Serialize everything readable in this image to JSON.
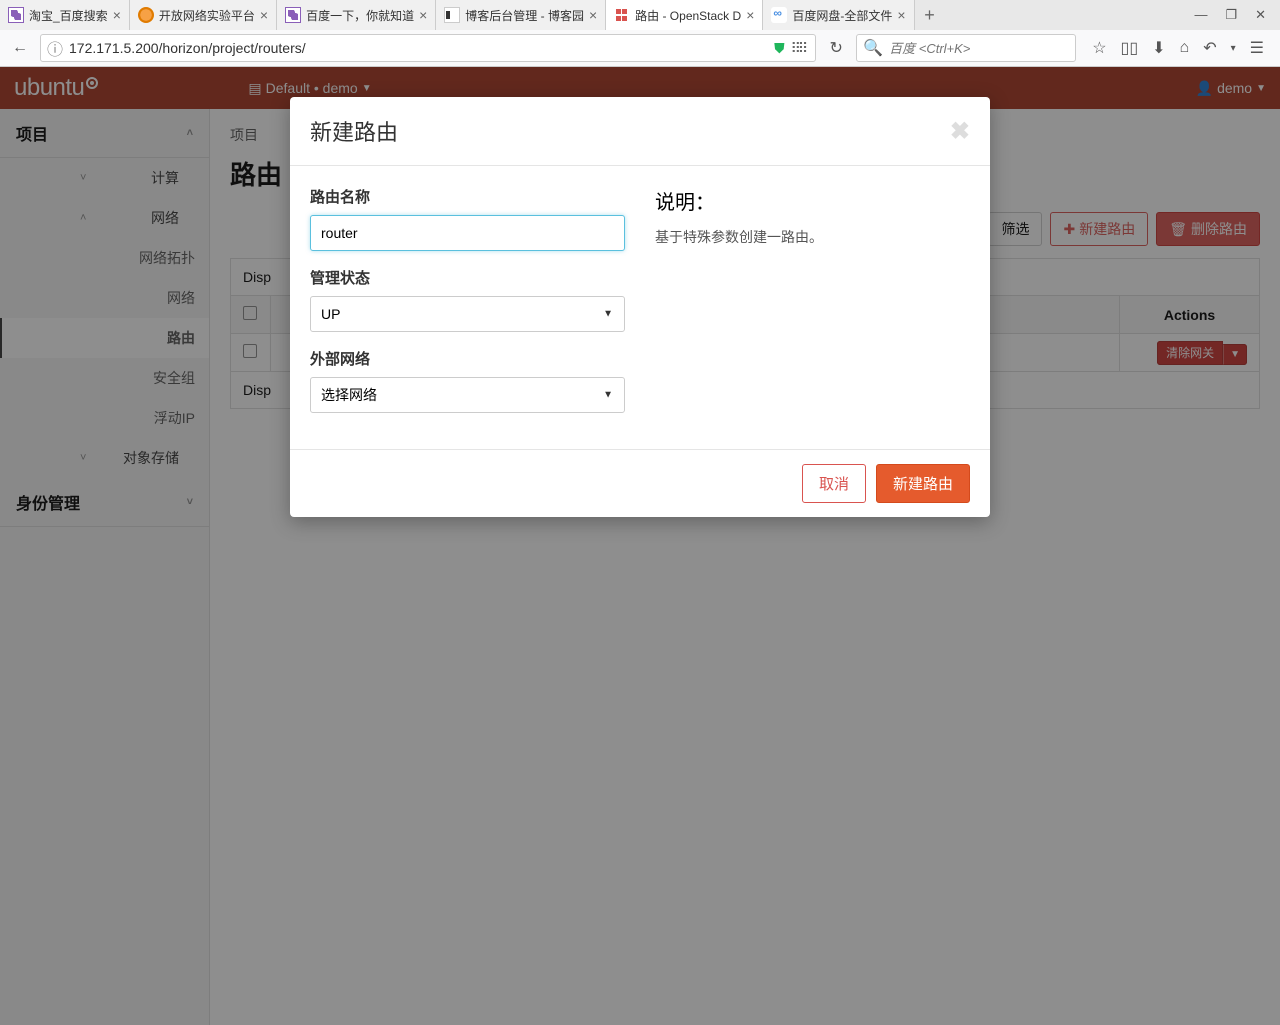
{
  "browser": {
    "tabs": [
      {
        "label": "淘宝_百度搜索",
        "favicon": "purple"
      },
      {
        "label": "开放网络实验平台",
        "favicon": "orange"
      },
      {
        "label": "百度一下，你就知道",
        "favicon": "purple"
      },
      {
        "label": "博客后台管理 - 博客园",
        "favicon": "cn"
      },
      {
        "label": "路由 - OpenStack D",
        "favicon": "os",
        "active": true
      },
      {
        "label": "百度网盘-全部文件",
        "favicon": "cloud"
      }
    ],
    "url": "172.171.5.200/horizon/project/routers/",
    "search_placeholder": "百度 <Ctrl+K>"
  },
  "header": {
    "logo": "ubuntu",
    "project_label": "Default • demo",
    "user_label": "demo"
  },
  "sidebar": {
    "project": "项目",
    "compute": "计算",
    "network": "网络",
    "items": {
      "topology": "网络拓扑",
      "networks": "网络",
      "routers": "路由",
      "security_groups": "安全组",
      "floating_ips": "浮动IP"
    },
    "object_storage": "对象存储",
    "identity": "身份管理"
  },
  "main": {
    "breadcrumb": "项目",
    "title": "路由",
    "filter_btn": "筛选",
    "create_btn": "新建路由",
    "delete_btn": "删除路由",
    "table": {
      "displaying_top": "Disp",
      "displaying_bottom": "Disp",
      "actions_header": "Actions",
      "row_action": "清除网关"
    }
  },
  "modal": {
    "title": "新建路由",
    "fields": {
      "name_label": "路由名称",
      "name_value": "router",
      "admin_state_label": "管理状态",
      "admin_state_value": "UP",
      "ext_net_label": "外部网络",
      "ext_net_value": "选择网络"
    },
    "desc_title": "说明：",
    "desc_text": "基于特殊参数创建一路由。",
    "cancel": "取消",
    "submit": "新建路由"
  }
}
